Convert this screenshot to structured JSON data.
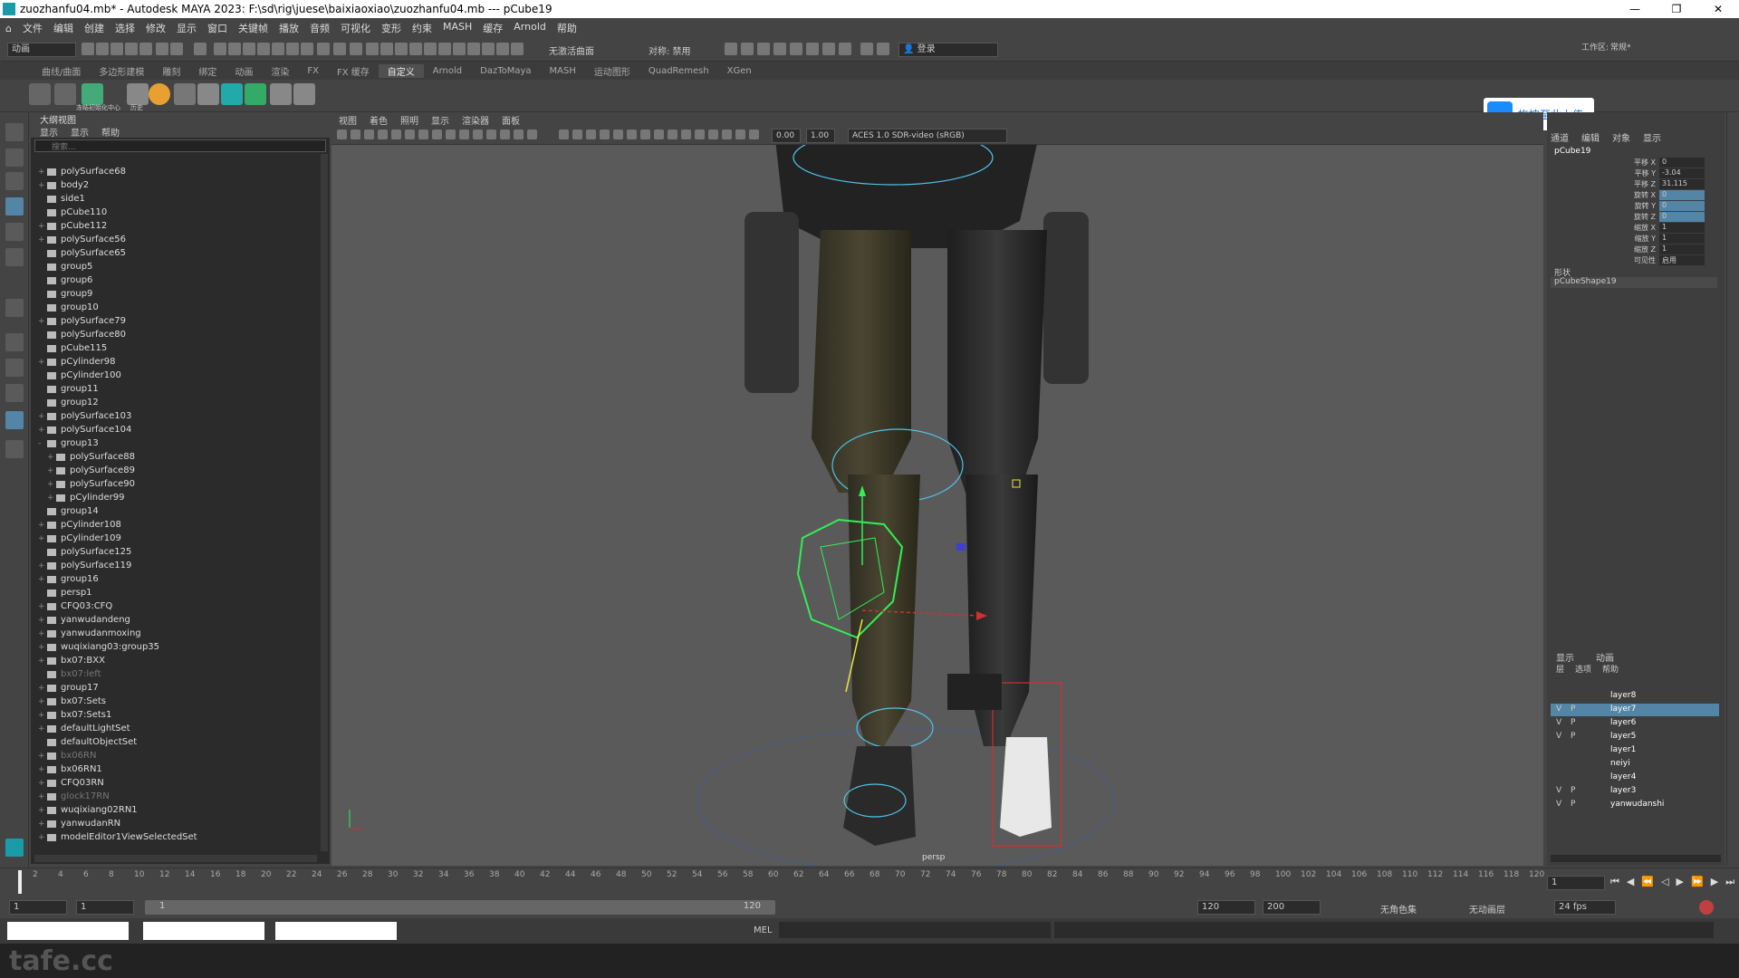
{
  "window": {
    "title": "zuozhanfu04.mb* - Autodesk MAYA 2023: F:\\sd\\rig\\juese\\baixiaoxiao\\zuozhanfu04.mb  ---  pCube19"
  },
  "menubar": [
    "文件",
    "编辑",
    "创建",
    "选择",
    "修改",
    "显示",
    "窗口",
    "关键帧",
    "播放",
    "音频",
    "可视化",
    "变形",
    "约束",
    "MASH",
    "缓存",
    "Arnold",
    "帮助"
  ],
  "toolbar": {
    "mode": "动画",
    "no_live_surface": "无激活曲面",
    "symmetry": "对称: 禁用",
    "login": "登录",
    "workspace_label": "工作区:",
    "workspace_value": "常规*"
  },
  "shelf_tabs": [
    "曲线/曲面",
    "多边形建模",
    "雕刻",
    "绑定",
    "动画",
    "渲染",
    "FX",
    "FX 缓存",
    "自定义",
    "Arnold",
    "DazToMaya",
    "MASH",
    "运动图形",
    "QuadRemesh",
    "XGen"
  ],
  "shelf_active": "自定义",
  "shelf_labels": {
    "item3": "冻结初始化中心",
    "item4": "历史"
  },
  "upload_banner": "拖拽至此上传",
  "outliner": {
    "header": "大纲视图",
    "menu": [
      "显示",
      "显示",
      "帮助"
    ],
    "search_placeholder": "搜索...",
    "rows": [
      {
        "name": "polySurface68",
        "exp": "+",
        "indent": 0,
        "dim": false
      },
      {
        "name": "body2",
        "exp": "+",
        "indent": 0,
        "dim": false
      },
      {
        "name": "side1",
        "exp": "",
        "indent": 0,
        "dim": false
      },
      {
        "name": "pCube110",
        "exp": "",
        "indent": 0,
        "dim": false
      },
      {
        "name": "pCube112",
        "exp": "+",
        "indent": 0,
        "dim": false
      },
      {
        "name": "polySurface56",
        "exp": "+",
        "indent": 0,
        "dim": false
      },
      {
        "name": "polySurface65",
        "exp": "",
        "indent": 0,
        "dim": false
      },
      {
        "name": "group5",
        "exp": "",
        "indent": 0,
        "dim": false
      },
      {
        "name": "group6",
        "exp": "",
        "indent": 0,
        "dim": false
      },
      {
        "name": "group9",
        "exp": "",
        "indent": 0,
        "dim": false
      },
      {
        "name": "group10",
        "exp": "",
        "indent": 0,
        "dim": false
      },
      {
        "name": "polySurface79",
        "exp": "+",
        "indent": 0,
        "dim": false
      },
      {
        "name": "polySurface80",
        "exp": "",
        "indent": 0,
        "dim": false
      },
      {
        "name": "pCube115",
        "exp": "",
        "indent": 0,
        "dim": false
      },
      {
        "name": "pCylinder98",
        "exp": "+",
        "indent": 0,
        "dim": false
      },
      {
        "name": "pCylinder100",
        "exp": "",
        "indent": 0,
        "dim": false
      },
      {
        "name": "group11",
        "exp": "",
        "indent": 0,
        "dim": false
      },
      {
        "name": "group12",
        "exp": "",
        "indent": 0,
        "dim": false
      },
      {
        "name": "polySurface103",
        "exp": "+",
        "indent": 0,
        "dim": false
      },
      {
        "name": "polySurface104",
        "exp": "+",
        "indent": 0,
        "dim": false
      },
      {
        "name": "group13",
        "exp": "-",
        "indent": 0,
        "dim": false
      },
      {
        "name": "polySurface88",
        "exp": "+",
        "indent": 1,
        "dim": false
      },
      {
        "name": "polySurface89",
        "exp": "+",
        "indent": 1,
        "dim": false
      },
      {
        "name": "polySurface90",
        "exp": "+",
        "indent": 1,
        "dim": false
      },
      {
        "name": "pCylinder99",
        "exp": "+",
        "indent": 1,
        "dim": false
      },
      {
        "name": "group14",
        "exp": "",
        "indent": 0,
        "dim": false
      },
      {
        "name": "pCylinder108",
        "exp": "+",
        "indent": 0,
        "dim": false
      },
      {
        "name": "pCylinder109",
        "exp": "+",
        "indent": 0,
        "dim": false
      },
      {
        "name": "polySurface125",
        "exp": "",
        "indent": 0,
        "dim": false
      },
      {
        "name": "polySurface119",
        "exp": "+",
        "indent": 0,
        "dim": false
      },
      {
        "name": "group16",
        "exp": "+",
        "indent": 0,
        "dim": false
      },
      {
        "name": "persp1",
        "exp": "",
        "indent": 0,
        "dim": false
      },
      {
        "name": "CFQ03:CFQ",
        "exp": "+",
        "indent": 0,
        "dim": false
      },
      {
        "name": "yanwudandeng",
        "exp": "+",
        "indent": 0,
        "dim": false
      },
      {
        "name": "yanwudanmoxing",
        "exp": "+",
        "indent": 0,
        "dim": false
      },
      {
        "name": "wuqixiang03:group35",
        "exp": "+",
        "indent": 0,
        "dim": false
      },
      {
        "name": "bx07:BXX",
        "exp": "+",
        "indent": 0,
        "dim": false
      },
      {
        "name": "bx07:left",
        "exp": "",
        "indent": 0,
        "dim": true
      },
      {
        "name": "group17",
        "exp": "+",
        "indent": 0,
        "dim": false
      },
      {
        "name": "bx07:Sets",
        "exp": "+",
        "indent": 0,
        "dim": false
      },
      {
        "name": "bx07:Sets1",
        "exp": "+",
        "indent": 0,
        "dim": false
      },
      {
        "name": "defaultLightSet",
        "exp": "+",
        "indent": 0,
        "dim": false
      },
      {
        "name": "defaultObjectSet",
        "exp": "",
        "indent": 0,
        "dim": false
      },
      {
        "name": "bx06RN",
        "exp": "+",
        "indent": 0,
        "dim": true
      },
      {
        "name": "bx06RN1",
        "exp": "+",
        "indent": 0,
        "dim": false
      },
      {
        "name": "CFQ03RN",
        "exp": "+",
        "indent": 0,
        "dim": false
      },
      {
        "name": "glock17RN",
        "exp": "+",
        "indent": 0,
        "dim": true
      },
      {
        "name": "wuqixiang02RN1",
        "exp": "+",
        "indent": 0,
        "dim": false
      },
      {
        "name": "yanwudanRN",
        "exp": "+",
        "indent": 0,
        "dim": false
      },
      {
        "name": "modelEditor1ViewSelectedSet",
        "exp": "+",
        "indent": 0,
        "dim": false
      }
    ]
  },
  "viewport": {
    "menu": [
      "视图",
      "着色",
      "照明",
      "显示",
      "渲染器",
      "面板"
    ],
    "field1": "0.00",
    "field2": "1.00",
    "colorspace": "ACES 1.0 SDR-video (sRGB)",
    "camera_label": "persp"
  },
  "channel_box": {
    "tabs": [
      "通道",
      "编辑",
      "对象",
      "显示"
    ],
    "object": "pCube19",
    "attrs": [
      {
        "label": "平移 X",
        "value": "0",
        "hl": false
      },
      {
        "label": "平移 Y",
        "value": "-3.04",
        "hl": false
      },
      {
        "label": "平移 Z",
        "value": "31.115",
        "hl": false
      },
      {
        "label": "旋转 X",
        "value": "0",
        "hl": true
      },
      {
        "label": "旋转 Y",
        "value": "0",
        "hl": true
      },
      {
        "label": "旋转 Z",
        "value": "0",
        "hl": true
      },
      {
        "label": "缩放 X",
        "value": "1",
        "hl": false
      },
      {
        "label": "缩放 Y",
        "value": "1",
        "hl": false
      },
      {
        "label": "缩放 Z",
        "value": "1",
        "hl": false
      },
      {
        "label": "可见性",
        "value": "启用",
        "hl": false
      }
    ],
    "shapes_label": "形状",
    "shape": "pCubeShape19"
  },
  "layers": {
    "tabs": [
      "显示",
      "动画"
    ],
    "menu": [
      "层",
      "选项",
      "帮助"
    ],
    "rows": [
      {
        "v": "",
        "p": "",
        "name": "layer8",
        "sel": false
      },
      {
        "v": "V",
        "p": "P",
        "name": "layer7",
        "sel": true
      },
      {
        "v": "V",
        "p": "P",
        "name": "layer6",
        "sel": false
      },
      {
        "v": "V",
        "p": "P",
        "name": "layer5",
        "sel": false
      },
      {
        "v": "",
        "p": "",
        "name": "layer1",
        "sel": false
      },
      {
        "v": "",
        "p": "",
        "name": "neiyi",
        "sel": false
      },
      {
        "v": "",
        "p": "",
        "name": "layer4",
        "sel": false
      },
      {
        "v": "V",
        "p": "P",
        "name": "layer3",
        "sel": false
      },
      {
        "v": "V",
        "p": "P",
        "name": "yanwudanshi",
        "sel": false
      }
    ]
  },
  "timeline": {
    "ticks": [
      "2",
      "4",
      "6",
      "8",
      "10",
      "12",
      "14",
      "16",
      "18",
      "20",
      "22",
      "24",
      "26",
      "28",
      "30",
      "32",
      "34",
      "36",
      "38",
      "40",
      "42",
      "44",
      "46",
      "48",
      "50",
      "52",
      "54",
      "56",
      "58",
      "60",
      "62",
      "64",
      "66",
      "68",
      "70",
      "72",
      "74",
      "76",
      "78",
      "80",
      "82",
      "84",
      "86",
      "88",
      "90",
      "92",
      "94",
      "96",
      "98",
      "100",
      "102",
      "104",
      "106",
      "108",
      "110",
      "112",
      "114",
      "116",
      "118",
      "120"
    ],
    "current_frame": "1"
  },
  "range": {
    "start": "1",
    "start2": "1",
    "slider_start": "1",
    "slider_end": "120",
    "end": "120",
    "end2": "200",
    "char_set": "无角色集",
    "anim_layer": "无动画层",
    "fps": "24 fps"
  },
  "statusbar": {
    "mel": "MEL"
  },
  "watermark": "tafe.cc"
}
